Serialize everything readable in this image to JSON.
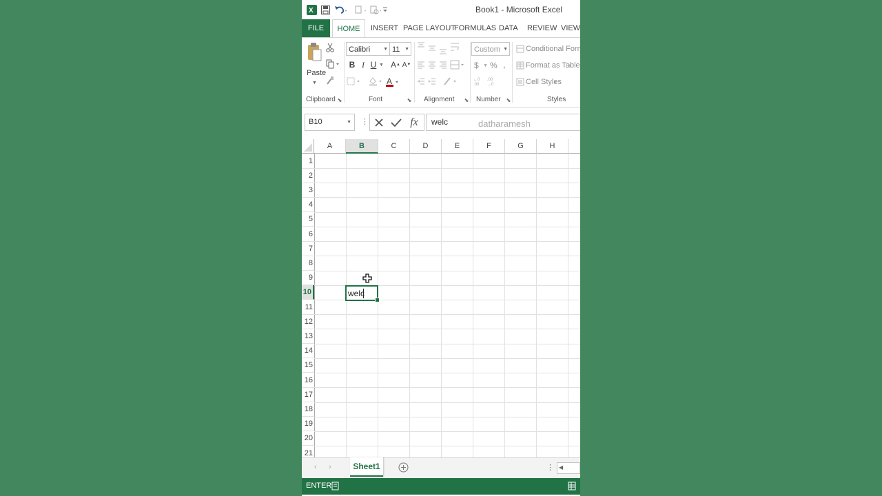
{
  "window": {
    "title": "Book1 - Microsoft Excel"
  },
  "quick_access": [
    "excel-logo-icon",
    "save-icon",
    "undo-icon",
    "redo-icon",
    "repeat-icon",
    "customize-qat-icon"
  ],
  "tabs": [
    "FILE",
    "HOME",
    "INSERT",
    "PAGE LAYOUT",
    "FORMULAS",
    "DATA",
    "REVIEW",
    "VIEW"
  ],
  "active_tab": "HOME",
  "ribbon": {
    "clipboard": {
      "paste_label": "Paste",
      "group_label": "Clipboard"
    },
    "font": {
      "font_name": "Calibri",
      "font_size": "11",
      "bold": "B",
      "italic": "I",
      "underline": "U",
      "grow": "A",
      "shrink": "A",
      "font_color_letter": "A",
      "group_label": "Font",
      "font_color": "#c00000"
    },
    "alignment": {
      "group_label": "Alignment"
    },
    "number": {
      "format": "Custom",
      "currency": "$",
      "percent": "%",
      "comma": ",",
      "group_label": "Number"
    },
    "styles": {
      "conditional": "Conditional Formatting",
      "format_table": "Format as Table",
      "cell_styles": "Cell Styles",
      "group_label": "Styles"
    }
  },
  "formula_bar": {
    "name_box": "B10",
    "content": "welc",
    "watermark": "datharamesh",
    "fx": "fx"
  },
  "grid": {
    "columns": [
      "A",
      "B",
      "C",
      "D",
      "E",
      "F",
      "G",
      "H"
    ],
    "rows": [
      "1",
      "2",
      "3",
      "4",
      "5",
      "6",
      "7",
      "8",
      "9",
      "10",
      "11",
      "12",
      "13",
      "14",
      "15",
      "16",
      "17",
      "18",
      "19",
      "20",
      "21"
    ],
    "active_cell": {
      "ref": "B10",
      "value": "welc"
    },
    "active_column": "B",
    "active_row": "10"
  },
  "sheets": {
    "active": "Sheet1"
  },
  "status": {
    "mode": "ENTER"
  },
  "colors": {
    "accent": "#217346",
    "background": "#43875f"
  }
}
